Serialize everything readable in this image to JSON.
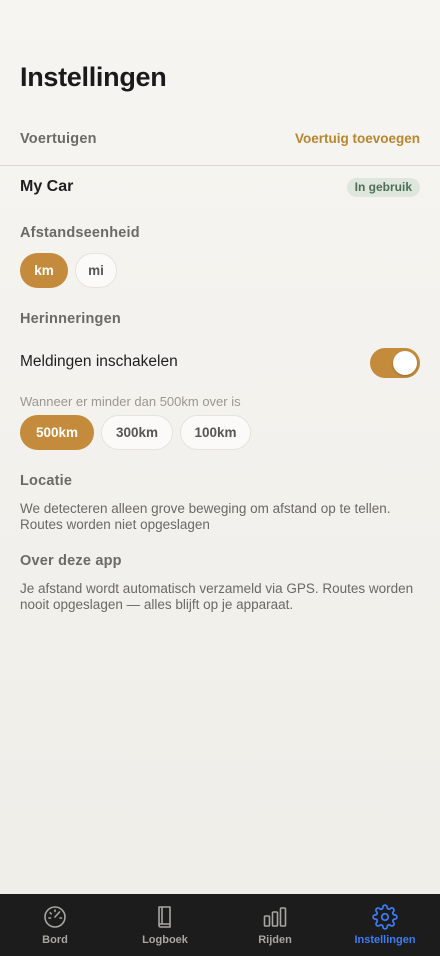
{
  "page": {
    "title": "Instellingen"
  },
  "vehicles": {
    "header": "Voertuigen",
    "add_label": "Voertuig toevoegen",
    "items": [
      {
        "name": "My Car",
        "status": "In gebruik"
      }
    ]
  },
  "distance_unit": {
    "header": "Afstandseenheid",
    "options": [
      "km",
      "mi"
    ],
    "selected": "km"
  },
  "reminders": {
    "header": "Herinneringen",
    "toggle_label": "Meldingen inschakelen",
    "enabled": true,
    "hint": "Wanneer er minder dan 500km over is",
    "options": [
      "500km",
      "300km",
      "100km"
    ],
    "selected": "500km"
  },
  "location": {
    "header": "Locatie",
    "text": "We detecteren alleen grove beweging om afstand op te tellen. Routes worden niet opgeslagen"
  },
  "about": {
    "header": "Over deze app",
    "text": "Je afstand wordt automatisch verzameld via GPS. Routes worden nooit opgeslagen — alles blijft op je apparaat."
  },
  "tabbar": {
    "tabs": [
      {
        "label": "Bord",
        "icon": "gauge-icon"
      },
      {
        "label": "Logboek",
        "icon": "book-icon"
      },
      {
        "label": "Rijden",
        "icon": "bar-chart-icon"
      },
      {
        "label": "Instellingen",
        "icon": "gear-icon"
      }
    ],
    "active": "Instellingen"
  },
  "colors": {
    "accent": "#c48b3c",
    "link": "#b8862f",
    "tab_active": "#3b7cf5",
    "badge_bg": "#dfe6de",
    "badge_text": "#4e6f57"
  }
}
